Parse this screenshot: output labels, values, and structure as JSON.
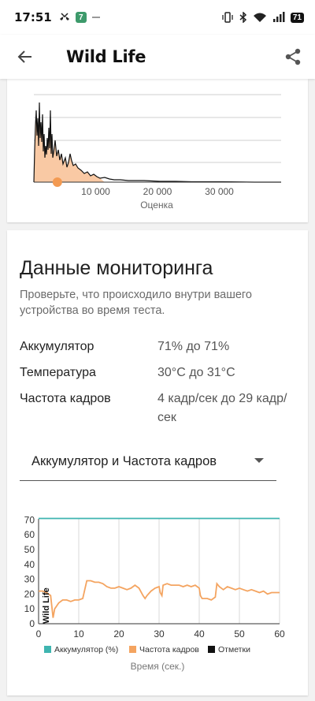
{
  "status": {
    "time": "17:51",
    "notif_badge": "7",
    "battery": "71"
  },
  "appbar": {
    "title": "Wild Life",
    "back_icon": "arrow-back-icon",
    "share_icon": "share-icon"
  },
  "score_chart": {
    "type": "area",
    "xlabel": "Оценка",
    "xticks": [
      "10 000",
      "20 000",
      "30 000"
    ],
    "xtick_values": [
      10000,
      20000,
      30000
    ],
    "xlim": [
      0,
      40000
    ],
    "marker_score": 3800,
    "colors": {
      "line": "#111111",
      "fill": "#f9c9a4",
      "marker": "#f39a52"
    }
  },
  "monitoring": {
    "title": "Данные мониторинга",
    "description": "Проверьте, что происходило внутри вашего устройства во время теста.",
    "rows": [
      {
        "label": "Аккумулятор",
        "value": "71% до 71%"
      },
      {
        "label": "Температура",
        "value": "30°C до 31°C"
      },
      {
        "label": "Частота кадров",
        "value": "4 кадр/сек до 29 кадр/сек"
      }
    ],
    "dropdown": {
      "selected": "Аккумулятор и Частота кадров"
    }
  },
  "chart_data": {
    "type": "line",
    "xlabel": "Время (сек.)",
    "ylabel": "",
    "xlim": [
      0,
      60
    ],
    "ylim": [
      0,
      75
    ],
    "xticks": [
      0,
      10,
      20,
      30,
      40,
      50,
      60
    ],
    "yticks": [
      0,
      10,
      20,
      30,
      40,
      50,
      60,
      70
    ],
    "annotation": "Wild Life",
    "legend": [
      "Аккумулятор (%)",
      "Частота кадров",
      "Отметки"
    ],
    "colors": {
      "battery": "#3fb5b0",
      "fps": "#f4a460",
      "marks": "#111111"
    },
    "series": [
      {
        "name": "Аккумулятор (%)",
        "x": [
          0,
          60
        ],
        "y": [
          71,
          71
        ]
      },
      {
        "name": "Частота кадров",
        "x": [
          0,
          1,
          2,
          3,
          3.6,
          4,
          5,
          6,
          7,
          8,
          9,
          10,
          11,
          12,
          13,
          14,
          15,
          16,
          17,
          18,
          19,
          20,
          21,
          22,
          23,
          24,
          25,
          26,
          26.5,
          27,
          28,
          29,
          30,
          30.3,
          30.7,
          31,
          32,
          33,
          34,
          35,
          36,
          37,
          38,
          39,
          40,
          40.3,
          40.7,
          41,
          42,
          43,
          44,
          44.4,
          45,
          46,
          47,
          48,
          49,
          50,
          51,
          52,
          53,
          54,
          55,
          56,
          57,
          58,
          59,
          60
        ],
        "y": [
          22,
          22,
          21,
          19,
          4,
          10,
          14,
          16,
          16,
          15,
          16,
          16,
          17,
          29,
          29,
          28,
          28,
          27,
          25,
          24,
          24,
          25,
          24,
          23,
          24,
          26,
          24,
          19,
          17,
          19,
          22,
          24,
          25,
          21,
          19,
          26,
          27,
          26,
          26,
          26,
          25,
          26,
          25,
          26,
          24,
          19,
          17,
          17,
          17,
          16,
          18,
          27,
          25,
          23,
          25,
          24,
          23,
          24,
          23,
          22,
          23,
          22,
          21,
          22,
          20,
          21,
          21,
          21
        ]
      },
      {
        "name": "Отметки",
        "x": [],
        "y": []
      }
    ]
  }
}
